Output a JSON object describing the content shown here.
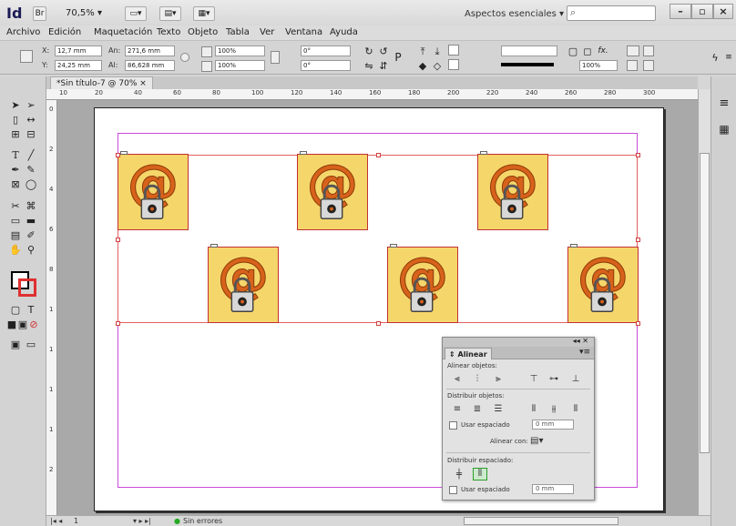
{
  "titlebar": {
    "app_logo": "Id",
    "bridge_label": "Br",
    "zoom": "70,5%",
    "workspace": "Aspectos esenciales",
    "search_icon": "⌕",
    "min_label": "–",
    "max_label": "▫",
    "close_label": "×"
  },
  "menu": [
    "Archivo",
    "Edición",
    "Maquetación",
    "Texto",
    "Objeto",
    "Tabla",
    "Ver",
    "Ventana",
    "Ayuda"
  ],
  "control": {
    "x_label": "X:",
    "x_value": "12,7 mm",
    "y_label": "Y:",
    "y_value": "24,25 mm",
    "w_label": "An:",
    "w_value": "271,6 mm",
    "h_label": "Al:",
    "h_value": "86,628 mm",
    "scale_x": "100%",
    "scale_y": "100%",
    "angle": "0°",
    "shear": "0°",
    "fx_label": "fx.",
    "opacity": "100%",
    "p_label": "P"
  },
  "document": {
    "tab_label": "*Sin título-7 @ 70%",
    "tab_close": "×"
  },
  "ruler_numbers": [
    "10",
    "20",
    "40",
    "60",
    "80",
    "100",
    "120",
    "140",
    "160",
    "180",
    "200",
    "220",
    "240",
    "260",
    "280",
    "300"
  ],
  "vruler_numbers": [
    "0",
    "2",
    "4",
    "6",
    "8",
    "1",
    "1",
    "1",
    "1",
    "2"
  ],
  "status": {
    "page": "1",
    "preflight": "Sin errores"
  },
  "align_panel": {
    "tab_label": "Alinear",
    "section_align": "Alinear objetos:",
    "section_distribute": "Distribuir objetos:",
    "use_spacing": "Usar espaciado",
    "spacing_value": "0 mm",
    "align_to": "Alinear con:",
    "section_distribute_spacing": "Distribuir espaciado:",
    "use_spacing_2": "Usar espaciado",
    "spacing_value_2": "0 mm"
  },
  "image_tile": {
    "at_symbol": "@",
    "tile_color": "#f5d66a",
    "at_color": "#d7621b"
  },
  "colors": {
    "margin_guide": "#c84bd8",
    "selection": "#e06060"
  }
}
